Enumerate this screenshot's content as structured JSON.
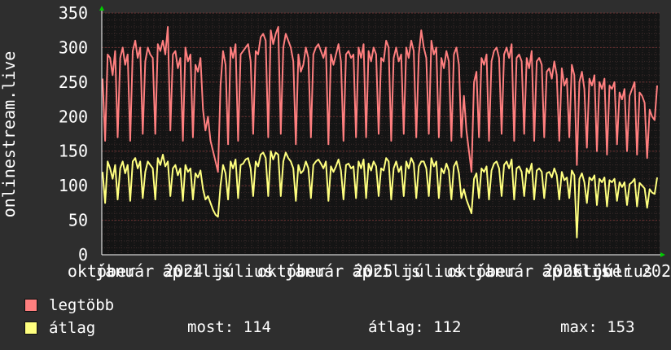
{
  "chart_data": {
    "type": "line",
    "ylabel": "onlinestream.live",
    "ylim": [
      0,
      350
    ],
    "yticks": [
      0,
      50,
      100,
      150,
      200,
      250,
      300,
      350
    ],
    "xtick_labels": [
      "október",
      "január 2024",
      "április",
      "július",
      "október",
      "január 2025",
      "április",
      "július",
      "október",
      "január 2026",
      "április",
      "július",
      "október 202"
    ],
    "grid": true,
    "series": [
      {
        "name": "legtöbb",
        "color": "#ff7f7f",
        "values": [
          255,
          165,
          290,
          285,
          260,
          295,
          170,
          285,
          300,
          275,
          290,
          165,
          295,
          310,
          285,
          300,
          175,
          280,
          300,
          290,
          285,
          175,
          305,
          295,
          310,
          290,
          330,
          180,
          290,
          295,
          270,
          285,
          165,
          300,
          280,
          290,
          170,
          275,
          265,
          285,
          210,
          180,
          200,
          165,
          150,
          135,
          120,
          245,
          295,
          275,
          160,
          300,
          285,
          305,
          165,
          290,
          295,
          300,
          305,
          280,
          175,
          295,
          290,
          315,
          320,
          310,
          170,
          325,
          305,
          320,
          330,
          175,
          300,
          320,
          310,
          300,
          280,
          160,
          290,
          265,
          275,
          300,
          285,
          170,
          290,
          300,
          305,
          295,
          285,
          300,
          160,
          290,
          275,
          290,
          305,
          280,
          165,
          290,
          295,
          285,
          290,
          170,
          300,
          285,
          305,
          170,
          295,
          280,
          300,
          290,
          175,
          285,
          280,
          310,
          300,
          165,
          285,
          300,
          280,
          290,
          175,
          300,
          285,
          310,
          295,
          170,
          290,
          325,
          300,
          285,
          175,
          310,
          290,
          300,
          170,
          285,
          270,
          295,
          280,
          165,
          290,
          300,
          275,
          170,
          230,
          180,
          150,
          120,
          250,
          265,
          170,
          285,
          275,
          290,
          165,
          280,
          295,
          300,
          285,
          175,
          290,
          300,
          285,
          305,
          165,
          285,
          290,
          280,
          175,
          285,
          270,
          295,
          165,
          280,
          285,
          275,
          170,
          265,
          270,
          255,
          280,
          260,
          165,
          270,
          245,
          255,
          170,
          275,
          260,
          130,
          250,
          265,
          240,
          155,
          255,
          245,
          260,
          150,
          250,
          240,
          255,
          145,
          245,
          240,
          250,
          160,
          235,
          225,
          240,
          150,
          230,
          240,
          250,
          145,
          235,
          230,
          220,
          140,
          210,
          200,
          195,
          245
        ]
      },
      {
        "name": "átlag",
        "color": "#ffff7f",
        "values": [
          120,
          75,
          135,
          125,
          110,
          130,
          80,
          125,
          135,
          118,
          130,
          78,
          135,
          140,
          125,
          135,
          82,
          120,
          135,
          130,
          125,
          80,
          140,
          130,
          145,
          128,
          135,
          85,
          125,
          130,
          115,
          125,
          78,
          130,
          120,
          125,
          80,
          118,
          112,
          122,
          95,
          80,
          85,
          75,
          65,
          58,
          55,
          100,
          130,
          118,
          80,
          135,
          125,
          138,
          82,
          130,
          132,
          138,
          140,
          125,
          85,
          135,
          128,
          145,
          148,
          140,
          85,
          150,
          138,
          148,
          145,
          85,
          135,
          148,
          140,
          135,
          125,
          78,
          130,
          118,
          122,
          135,
          125,
          82,
          130,
          135,
          138,
          132,
          125,
          135,
          78,
          128,
          120,
          128,
          138,
          122,
          80,
          130,
          132,
          125,
          128,
          82,
          135,
          125,
          138,
          82,
          132,
          122,
          135,
          128,
          85,
          125,
          122,
          140,
          135,
          80,
          125,
          135,
          120,
          128,
          85,
          135,
          125,
          140,
          132,
          82,
          128,
          135,
          135,
          125,
          85,
          140,
          128,
          135,
          82,
          125,
          118,
          132,
          122,
          80,
          128,
          135,
          118,
          82,
          95,
          80,
          70,
          60,
          110,
          118,
          82,
          125,
          120,
          128,
          80,
          122,
          132,
          135,
          125,
          85,
          130,
          135,
          125,
          138,
          80,
          125,
          128,
          120,
          85,
          125,
          118,
          132,
          80,
          122,
          125,
          120,
          82,
          118,
          120,
          112,
          125,
          115,
          80,
          120,
          108,
          112,
          82,
          122,
          115,
          25,
          110,
          118,
          105,
          75,
          112,
          108,
          115,
          72,
          110,
          105,
          112,
          70,
          108,
          105,
          110,
          78,
          105,
          98,
          105,
          72,
          102,
          105,
          110,
          70,
          104,
          100,
          96,
          68,
          95,
          90,
          88,
          112
        ]
      }
    ]
  },
  "legend": {
    "items": [
      {
        "label": "legtöbb",
        "color": "#ff7f7f"
      },
      {
        "label": "átlag",
        "color": "#ffff7f"
      }
    ]
  },
  "stats": {
    "most": "most: 114",
    "atlag": "átlag: 112",
    "max": "max: 153"
  }
}
